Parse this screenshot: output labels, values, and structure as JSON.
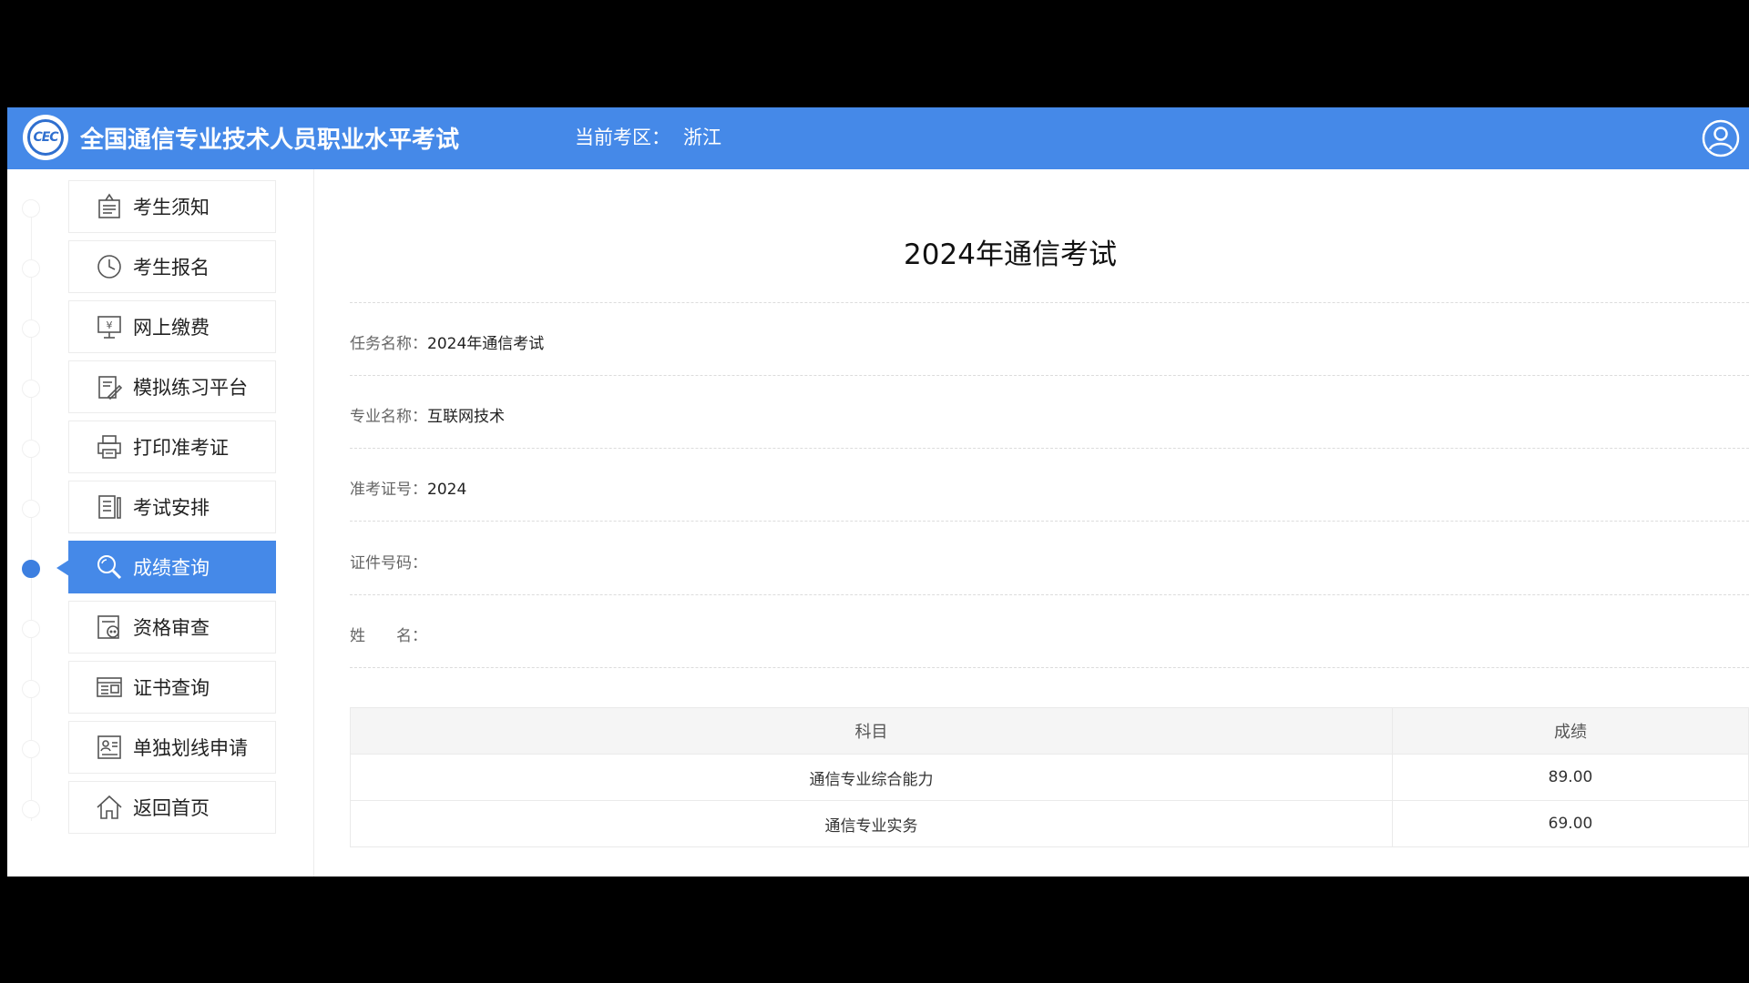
{
  "header": {
    "logo_text": "CEC",
    "title": "全国通信专业技术人员职业水平考试",
    "region_label": "当前考区：",
    "region_value": "浙江"
  },
  "sidebar": {
    "items": [
      {
        "label": "考生须知",
        "icon": "notice-icon",
        "active": false
      },
      {
        "label": "考生报名",
        "icon": "clock-icon",
        "active": false
      },
      {
        "label": "网上缴费",
        "icon": "payment-icon",
        "active": false
      },
      {
        "label": "模拟练习平台",
        "icon": "practice-icon",
        "active": false
      },
      {
        "label": "打印准考证",
        "icon": "printer-icon",
        "active": false
      },
      {
        "label": "考试安排",
        "icon": "schedule-icon",
        "active": false
      },
      {
        "label": "成绩查询",
        "icon": "search-icon",
        "active": true
      },
      {
        "label": "资格审查",
        "icon": "review-icon",
        "active": false
      },
      {
        "label": "证书查询",
        "icon": "certificate-icon",
        "active": false
      },
      {
        "label": "单独划线申请",
        "icon": "application-icon",
        "active": false
      },
      {
        "label": "返回首页",
        "icon": "home-icon",
        "active": false
      }
    ]
  },
  "main": {
    "title": "2024年通信考试",
    "fields": [
      {
        "label": "任务名称：",
        "value": "2024年通信考试"
      },
      {
        "label": "专业名称：",
        "value": "互联网技术"
      },
      {
        "label": "准考证号：",
        "value": "2024"
      },
      {
        "label": "证件号码：",
        "value": ""
      },
      {
        "label": "姓　　名：",
        "value": ""
      }
    ],
    "table": {
      "headers": [
        "科目",
        "成绩"
      ],
      "rows": [
        [
          "通信专业综合能力",
          "89.00"
        ],
        [
          "通信专业实务",
          "69.00"
        ]
      ]
    }
  },
  "colors": {
    "primary": "#4589e8",
    "active_dot": "#3d7fe0",
    "background": "#ffffff"
  }
}
